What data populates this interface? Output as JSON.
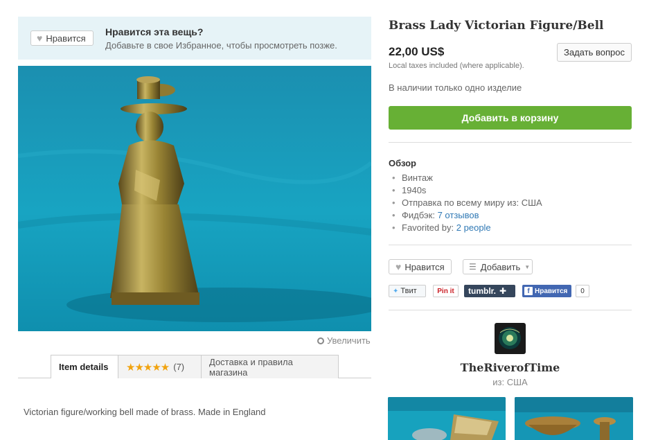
{
  "favorite_banner": {
    "button_label": "Нравится",
    "title": "Нравится эта вещь?",
    "subtitle": "Добавьте в свое Избранное, чтобы просмотреть позже."
  },
  "image": {
    "zoom_label": "Увеличить"
  },
  "tabs": [
    {
      "label": "Item details"
    },
    {
      "label": "(7)",
      "stars": "★★★★★"
    },
    {
      "label": "Доставка и правила магазина"
    }
  ],
  "description": "Victorian figure/working bell made of brass. Made in England",
  "listing": {
    "title": "Brass Lady Victorian Figure/Bell",
    "price": "22,00 US$",
    "tax_note": "Local taxes included (where applicable).",
    "ask_button": "Задать вопрос",
    "stock_note": "В наличии только одно изделие",
    "cart_button": "Добавить в корзину"
  },
  "overview": {
    "title": "Обзор",
    "items": {
      "vintage": "Винтаж",
      "era": "1940s",
      "shipping": "Отправка по всему миру из: США",
      "feedback_label": "Фидбэк:",
      "feedback_link": "7 отзывов",
      "favorited_label": "Favorited by:",
      "favorited_link": "2 people"
    }
  },
  "actions": {
    "like_label": "Нравится",
    "add_label": "Добавить"
  },
  "share": {
    "tweet": "Твит",
    "pin": "Pin it",
    "tumblr": "tumblr.",
    "facebook": "Нравится",
    "count": "0"
  },
  "shop": {
    "name": "TheRiverofTime",
    "location": "из: США"
  },
  "colors": {
    "accent_green": "#67b035",
    "link_blue": "#3079b5",
    "banner_bg": "#e6f3f7",
    "star_orange": "#f1a30f"
  }
}
